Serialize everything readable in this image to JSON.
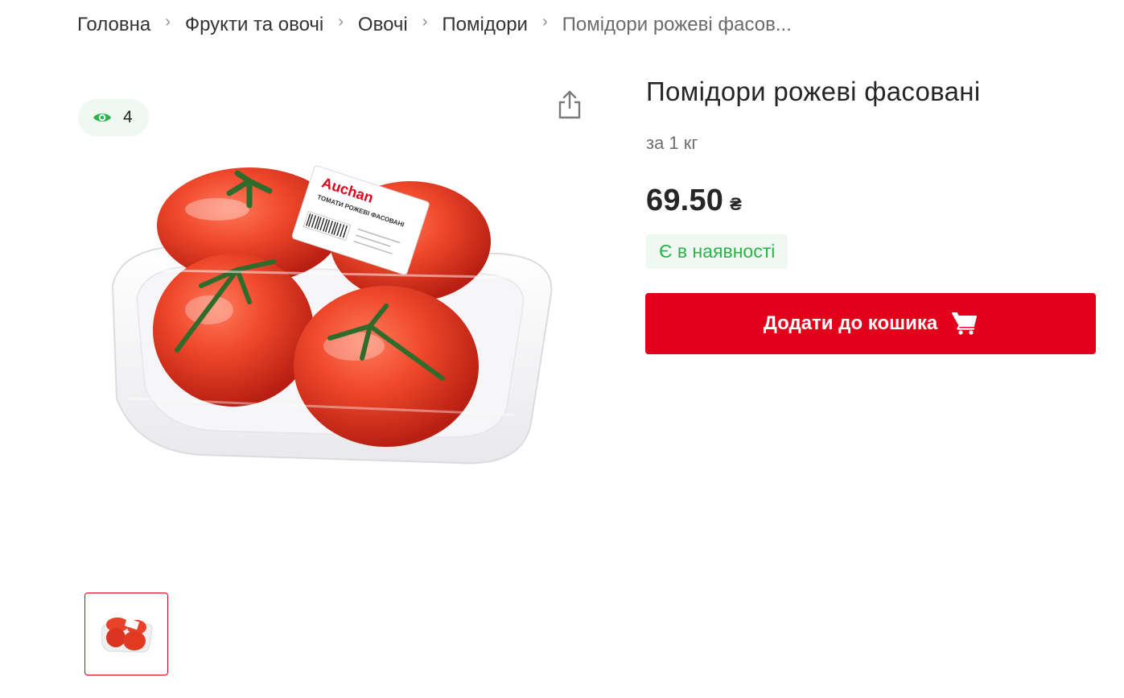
{
  "breadcrumb": {
    "items": [
      {
        "label": "Головна"
      },
      {
        "label": "Фрукти та овочі"
      },
      {
        "label": "Овочі"
      },
      {
        "label": "Помідори"
      },
      {
        "label": "Помідори рожеві фасов..."
      }
    ],
    "separator": "›"
  },
  "gallery": {
    "views_count": "4",
    "views_icon": "eye-icon",
    "share_icon": "share-icon",
    "image_label_brand": "Auchan",
    "image_label_text": "ТОМАТИ РОЖЕВІ ФАСОВАНІ",
    "thumbnails_count": 1
  },
  "product": {
    "title": "Помідори рожеві фасовані",
    "unit": "за 1 кг",
    "price": "69.50",
    "currency": "₴",
    "stock_status": "Є в наявності",
    "add_to_cart_label": "Додати до кошика",
    "cart_icon": "cart-icon"
  },
  "colors": {
    "accent_red": "#e2001a",
    "stock_green": "#2bb34c",
    "badge_bg": "#f0f8f2",
    "text_dark": "#262626",
    "text_muted": "#6e6e6e"
  }
}
